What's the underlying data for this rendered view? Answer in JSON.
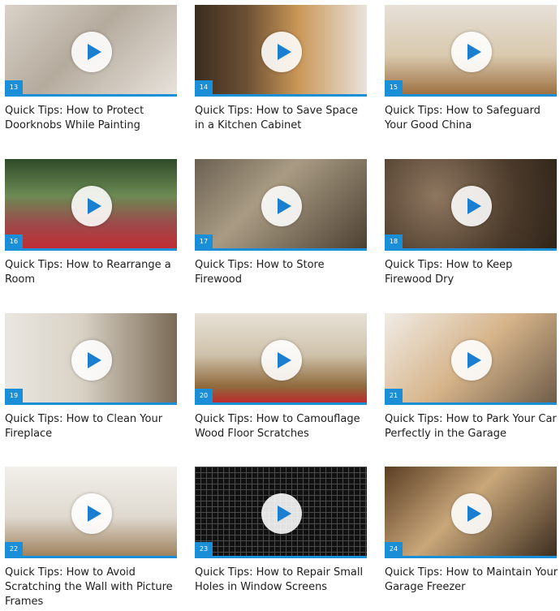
{
  "videos": [
    {
      "number": "13",
      "title": "Quick Tips: How to Protect Doorknobs While Painting"
    },
    {
      "number": "14",
      "title": "Quick Tips: How to Save Space in a Kitchen Cabinet"
    },
    {
      "number": "15",
      "title": "Quick Tips: How to Safeguard Your Good China"
    },
    {
      "number": "16",
      "title": "Quick Tips: How to Rearrange a Room"
    },
    {
      "number": "17",
      "title": "Quick Tips: How to Store Firewood"
    },
    {
      "number": "18",
      "title": "Quick Tips: How to Keep Firewood Dry"
    },
    {
      "number": "19",
      "title": "Quick Tips: How to Clean Your Fireplace"
    },
    {
      "number": "20",
      "title": "Quick Tips: How to Camouflage Wood Floor Scratches"
    },
    {
      "number": "21",
      "title": "Quick Tips: How to Park Your Car Perfectly in the Garage"
    },
    {
      "number": "22",
      "title": "Quick Tips: How to Avoid Scratching the Wall with Picture Frames"
    },
    {
      "number": "23",
      "title": "Quick Tips: How to Repair Small Holes in Window Screens"
    },
    {
      "number": "24",
      "title": "Quick Tips: How to Maintain Your Garage Freezer"
    }
  ],
  "icons": {
    "play": "play-icon"
  },
  "colors": {
    "accent": "#1a8fd8",
    "text": "#1d1d1d"
  }
}
